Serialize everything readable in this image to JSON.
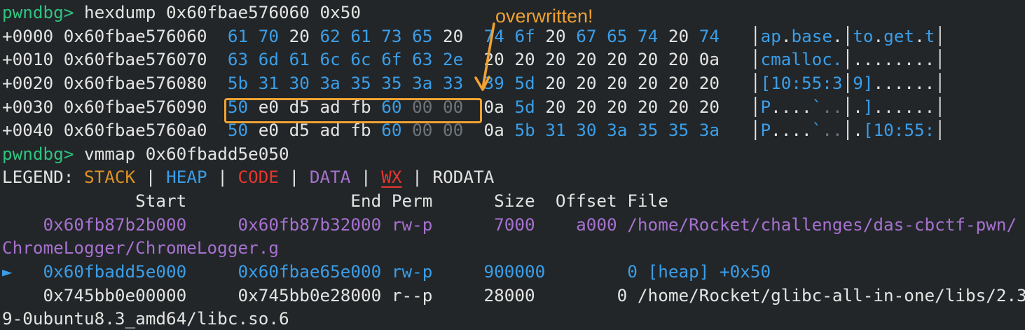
{
  "colors": {
    "bg": "#222629",
    "white": "#e4e4e2",
    "blue": "#3b9ee8",
    "gray": "#6f7478",
    "green": "#2fc380",
    "stack_orange": "#df9224",
    "annot_orange": "#f0a232",
    "red": "#e8362e",
    "purple": "#a771cf"
  },
  "annotation": {
    "label": "overwritten!"
  },
  "terminal": {
    "lines": [
      {
        "name": "prompt-hexdump-line",
        "segments": [
          {
            "t": "pwndbg> ",
            "c": "green"
          },
          {
            "t": "hexdump 0x60fbae576060 0x50",
            "c": "white"
          }
        ]
      },
      {
        "name": "hexdump-row-0000",
        "segments": [
          {
            "t": "+0000 0x60fbae576060  ",
            "c": "white"
          },
          {
            "t": "61 70 ",
            "c": "blue"
          },
          {
            "t": "20 ",
            "c": "white"
          },
          {
            "t": "62 61 73 65 ",
            "c": "blue"
          },
          {
            "t": "20  ",
            "c": "white"
          },
          {
            "t": "74 6f ",
            "c": "blue"
          },
          {
            "t": "20 ",
            "c": "white"
          },
          {
            "t": "67 65 74 ",
            "c": "blue"
          },
          {
            "t": "20 ",
            "c": "white"
          },
          {
            "t": "74",
            "c": "blue"
          },
          {
            "t": "   │",
            "c": "white"
          },
          {
            "t": "ap",
            "c": "blue"
          },
          {
            "t": ".",
            "c": "white"
          },
          {
            "t": "base",
            "c": "blue"
          },
          {
            "t": ".",
            "c": "white"
          },
          {
            "t": "│",
            "c": "white"
          },
          {
            "t": "to",
            "c": "blue"
          },
          {
            "t": ".",
            "c": "white"
          },
          {
            "t": "get",
            "c": "blue"
          },
          {
            "t": ".",
            "c": "white"
          },
          {
            "t": "t",
            "c": "blue"
          },
          {
            "t": "│",
            "c": "white"
          }
        ]
      },
      {
        "name": "hexdump-row-0010",
        "segments": [
          {
            "t": "+0010 0x60fbae576070  ",
            "c": "white"
          },
          {
            "t": "63 6d 61 6c 6c 6f 63 2e",
            "c": "blue"
          },
          {
            "t": "  20 20 20 20 20 20 20 0a",
            "c": "white"
          },
          {
            "t": "   │",
            "c": "white"
          },
          {
            "t": "cmalloc.",
            "c": "blue"
          },
          {
            "t": "│",
            "c": "white"
          },
          {
            "t": "........",
            "c": "white"
          },
          {
            "t": "│",
            "c": "white"
          }
        ]
      },
      {
        "name": "hexdump-row-0020",
        "segments": [
          {
            "t": "+0020 0x60fbae576080  ",
            "c": "white"
          },
          {
            "t": "5b 31 30 3a 35 35 3a 33",
            "c": "blue"
          },
          {
            "t": "  ",
            "c": "white"
          },
          {
            "t": "39 5d ",
            "c": "blue"
          },
          {
            "t": "20 20 20 20 20 20",
            "c": "white"
          },
          {
            "t": "   │",
            "c": "white"
          },
          {
            "t": "[10:55:3",
            "c": "blue"
          },
          {
            "t": "│",
            "c": "white"
          },
          {
            "t": "9]",
            "c": "blue"
          },
          {
            "t": "......",
            "c": "white"
          },
          {
            "t": "│",
            "c": "white"
          }
        ]
      },
      {
        "name": "hexdump-row-0030",
        "segments": [
          {
            "t": "+0030 0x60fbae576090  ",
            "c": "white"
          },
          {
            "t": "50 ",
            "c": "blue"
          },
          {
            "t": "e0 d5 ad fb ",
            "c": "white"
          },
          {
            "t": "60 ",
            "c": "blue"
          },
          {
            "t": "00 00",
            "c": "gray"
          },
          {
            "t": "  0a ",
            "c": "white"
          },
          {
            "t": "5d ",
            "c": "blue"
          },
          {
            "t": "20 20 20 20 20 20",
            "c": "white"
          },
          {
            "t": "   │",
            "c": "white"
          },
          {
            "t": "P",
            "c": "blue"
          },
          {
            "t": "....",
            "c": "white"
          },
          {
            "t": "`",
            "c": "blue"
          },
          {
            "t": "..",
            "c": "gray"
          },
          {
            "t": "│",
            "c": "white"
          },
          {
            "t": ".",
            "c": "white"
          },
          {
            "t": "]",
            "c": "blue"
          },
          {
            "t": "......",
            "c": "white"
          },
          {
            "t": "│",
            "c": "white"
          }
        ]
      },
      {
        "name": "hexdump-row-0040",
        "segments": [
          {
            "t": "+0040 0x60fbae5760a0  ",
            "c": "white"
          },
          {
            "t": "50 ",
            "c": "blue"
          },
          {
            "t": "e0 d5 ad fb ",
            "c": "white"
          },
          {
            "t": "60 ",
            "c": "blue"
          },
          {
            "t": "00 00",
            "c": "gray"
          },
          {
            "t": "  0a ",
            "c": "white"
          },
          {
            "t": "5b 31 30 3a 35 35 3a",
            "c": "blue"
          },
          {
            "t": "   │",
            "c": "white"
          },
          {
            "t": "P",
            "c": "blue"
          },
          {
            "t": "....",
            "c": "white"
          },
          {
            "t": "`",
            "c": "blue"
          },
          {
            "t": "..",
            "c": "gray"
          },
          {
            "t": "│",
            "c": "white"
          },
          {
            "t": ".",
            "c": "white"
          },
          {
            "t": "[10:55:",
            "c": "blue"
          },
          {
            "t": "│",
            "c": "white"
          }
        ]
      },
      {
        "name": "prompt-vmmap-line",
        "segments": [
          {
            "t": "pwndbg> ",
            "c": "green"
          },
          {
            "t": "vmmap 0x60fbadd5e050",
            "c": "white"
          }
        ]
      },
      {
        "name": "legend-line",
        "segments": [
          {
            "t": "LEGEND: ",
            "c": "white"
          },
          {
            "t": "STACK",
            "c": "orange"
          },
          {
            "t": " | ",
            "c": "white"
          },
          {
            "t": "HEAP",
            "c": "blue"
          },
          {
            "t": " | ",
            "c": "white"
          },
          {
            "t": "CODE",
            "c": "red"
          },
          {
            "t": " | ",
            "c": "white"
          },
          {
            "t": "DATA",
            "c": "purple"
          },
          {
            "t": " | ",
            "c": "white"
          },
          {
            "t": "WX",
            "c": "red_ul"
          },
          {
            "t": " | ",
            "c": "white"
          },
          {
            "t": "RODATA",
            "c": "white"
          }
        ]
      },
      {
        "name": "vmmap-header-line",
        "segments": [
          {
            "t": "             Start                End Perm      Size  Offset File",
            "c": "white"
          }
        ]
      },
      {
        "name": "vmmap-row-chromelogger",
        "segments": [
          {
            "t": "    0x60fb87b2b000     0x60fb87b32000 rw-p      7000    a000 /home/Rocket/challenges/das-cbctf-pwn/",
            "c": "purple"
          }
        ]
      },
      {
        "name": "vmmap-row-chromelogger-wrap",
        "segments": [
          {
            "t": "ChromeLogger/ChromeLogger.g",
            "c": "purple"
          }
        ]
      },
      {
        "name": "vmmap-row-heap",
        "segments": [
          {
            "t": "►   0x60fbadd5e000     0x60fbae65e000 rw-p     900000        0 [heap] +0x50",
            "c": "blue"
          }
        ]
      },
      {
        "name": "vmmap-row-libc",
        "segments": [
          {
            "t": "    0x745bb0e00000     0x745bb0e28000 r--p     28000        0 /home/Rocket/glibc-all-in-one/libs/2.3",
            "c": "white"
          }
        ]
      },
      {
        "name": "vmmap-row-libc-wrap",
        "segments": [
          {
            "t": "9-0ubuntu8.3_amd64/libc.so.6",
            "c": "white"
          }
        ]
      }
    ]
  }
}
